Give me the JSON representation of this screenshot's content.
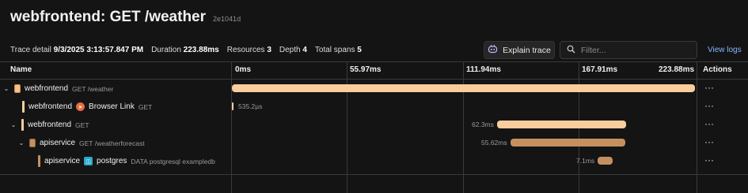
{
  "header": {
    "title": "webfrontend: GET /weather",
    "trace_id": "2e1041d"
  },
  "summary": {
    "trace_detail_label": "Trace detail",
    "trace_detail_value": "9/3/2025 3:13:57.847 PM",
    "duration_label": "Duration",
    "duration_value": "223.88ms",
    "resources_label": "Resources",
    "resources_value": "3",
    "depth_label": "Depth",
    "depth_value": "4",
    "total_spans_label": "Total spans",
    "total_spans_value": "5"
  },
  "toolbar": {
    "explain_label": "Explain trace",
    "filter_placeholder": "Filter...",
    "view_logs_label": "View logs"
  },
  "table": {
    "name_header": "Name",
    "actions_header": "Actions",
    "ticks": [
      "0ms",
      "55.97ms",
      "111.94ms",
      "167.91ms",
      "223.88ms"
    ]
  },
  "colors": {
    "webfrontend": "#f7c99a",
    "apiservice": "#c08a58",
    "background": "#141414"
  },
  "spans": [
    {
      "service": "webfrontend",
      "op": "GET /weather",
      "peer": "",
      "start_ms": 0,
      "duration_ms": 223.88,
      "duration_label": "",
      "color": "#f9cd9c"
    },
    {
      "service": "webfrontend",
      "op": "GET",
      "peer": "Browser Link",
      "start_ms": 0,
      "duration_ms": 0.5352,
      "duration_label": "535.2µs",
      "color": "#f9cd9c"
    },
    {
      "service": "webfrontend",
      "op": "GET",
      "peer": "",
      "start_ms": 128.3,
      "duration_ms": 62.3,
      "duration_label": "62.3ms",
      "color": "#f9cd9c"
    },
    {
      "service": "apiservice",
      "op": "GET /weatherforecast",
      "peer": "",
      "start_ms": 134.7,
      "duration_ms": 55.62,
      "duration_label": "55.62ms",
      "color": "#c49060"
    },
    {
      "service": "apiservice",
      "op": "DATA postgresql exampledb",
      "peer": "postgres",
      "start_ms": 176.8,
      "duration_ms": 7.1,
      "duration_label": "7.1ms",
      "color": "#c49060"
    }
  ],
  "actions_glyph": "···"
}
